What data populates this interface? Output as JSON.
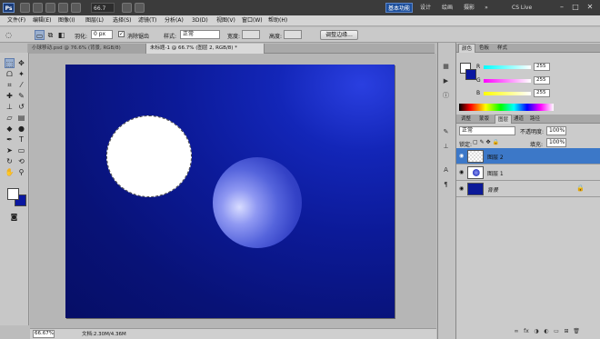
{
  "app": {
    "logo": "Ps",
    "zoom": "66.7",
    "workspaces": [
      "基本功能",
      "设计",
      "绘画",
      "摄影"
    ],
    "active_workspace": "基本功能",
    "more": "»",
    "cslive": "CS Live",
    "window_controls": [
      "–",
      "□",
      "✕"
    ]
  },
  "menu": [
    "文件(F)",
    "编辑(E)",
    "图像(I)",
    "图层(L)",
    "选择(S)",
    "滤镜(T)",
    "分析(A)",
    "3D(D)",
    "视图(V)",
    "窗口(W)",
    "帮助(H)"
  ],
  "options": {
    "feather_label": "羽化:",
    "feather_value": "0 px",
    "antialias_label": "消除锯齿",
    "antialias_checked": "✓",
    "style_label": "样式:",
    "style_value": "正常",
    "width_label": "宽度:",
    "height_label": "高度:",
    "refine_button": "调整边缘..."
  },
  "doc_tabs": [
    {
      "label": "小球移动.psd @ 76.6% (背景, RGB/8)",
      "active": false
    },
    {
      "label": "未标题-1 @ 66.7% (图层 2, RGB/8) *",
      "active": true
    }
  ],
  "status": {
    "zoom": "66.67%",
    "doc": "文档:2.30M/4.36M"
  },
  "color_panel": {
    "tabs": [
      "颜色",
      "色板",
      "样式"
    ],
    "channels": [
      {
        "label": "R",
        "value": "255"
      },
      {
        "label": "G",
        "value": "255"
      },
      {
        "label": "B",
        "value": "255"
      }
    ]
  },
  "adjust_tabs": [
    "调整",
    "蒙版"
  ],
  "layers_panel": {
    "tabs": [
      "图层",
      "通道",
      "路径"
    ],
    "blend_mode": "正常",
    "opacity_label": "不透明度:",
    "opacity_value": "100%",
    "lock_label": "锁定:",
    "fill_label": "填充:",
    "fill_value": "100%",
    "layers": [
      {
        "name": "图层 2",
        "selected": true
      },
      {
        "name": "图层 1",
        "selected": false
      },
      {
        "name": "背景",
        "selected": false
      }
    ]
  },
  "colors": {
    "accent": "#1d4f9c",
    "canvas_blue": "#0c1a98",
    "selected_layer": "#3c78c8"
  }
}
